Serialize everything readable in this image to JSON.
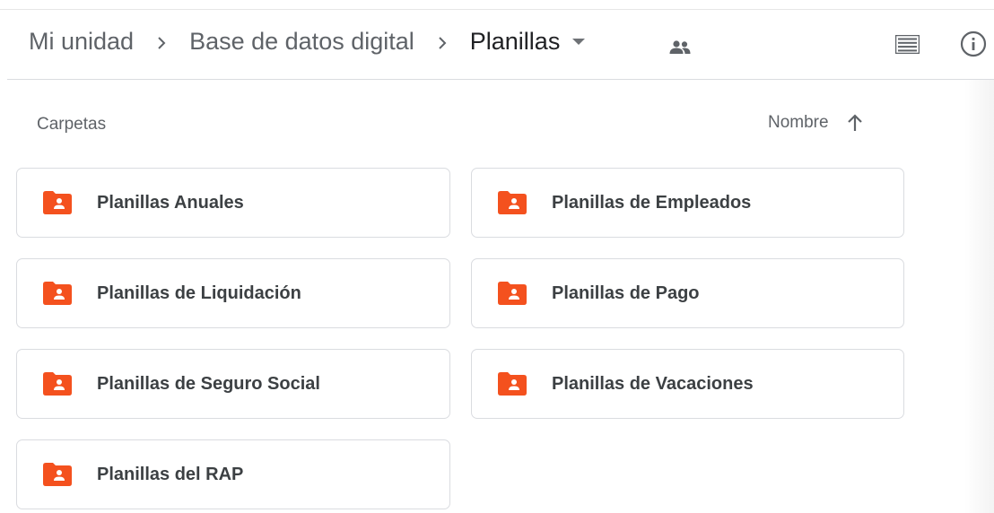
{
  "breadcrumb": {
    "items": [
      {
        "label": "Mi unidad"
      },
      {
        "label": "Base de datos digital"
      },
      {
        "label": "Planillas"
      }
    ]
  },
  "toolbar": {
    "shared_icon": "people-icon",
    "view_icon": "list-view-icon",
    "info_icon": "info-icon"
  },
  "folders_section": {
    "label": "Carpetas",
    "sort_label": "Nombre",
    "sort_direction": "ascending"
  },
  "folders": [
    {
      "name": "Planillas Anuales"
    },
    {
      "name": "Planillas de Empleados"
    },
    {
      "name": "Planillas de Liquidación"
    },
    {
      "name": "Planillas de Pago"
    },
    {
      "name": "Planillas de Seguro Social"
    },
    {
      "name": "Planillas de Vacaciones"
    },
    {
      "name": "Planillas del RAP"
    }
  ],
  "colors": {
    "folder_icon": "#f4511e",
    "text_primary": "#202124",
    "text_secondary": "#5f6368",
    "border": "#dadce0"
  }
}
